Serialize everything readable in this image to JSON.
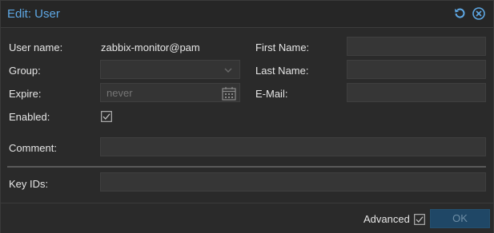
{
  "window": {
    "title": "Edit: User"
  },
  "tools": {
    "reset_icon": "reset-icon",
    "close_icon": "close-circle-icon"
  },
  "form": {
    "username": {
      "label": "User name:",
      "value": "zabbix-monitor@pam"
    },
    "group": {
      "label": "Group:",
      "value": ""
    },
    "expire": {
      "label": "Expire:",
      "placeholder": "never"
    },
    "enabled": {
      "label": "Enabled:",
      "checked": true
    },
    "comment": {
      "label": "Comment:",
      "value": ""
    },
    "firstname": {
      "label": "First Name:",
      "value": ""
    },
    "lastname": {
      "label": "Last Name:",
      "value": ""
    },
    "email": {
      "label": "E-Mail:",
      "value": ""
    },
    "keyids": {
      "label": "Key IDs:",
      "value": ""
    }
  },
  "footer": {
    "advanced_label": "Advanced",
    "advanced_checked": true,
    "ok_label": "OK"
  },
  "colors": {
    "accent": "#5ea8e5",
    "ok_bg": "#1f4766",
    "background": "#2a2a2a",
    "field_bg": "#363636"
  }
}
